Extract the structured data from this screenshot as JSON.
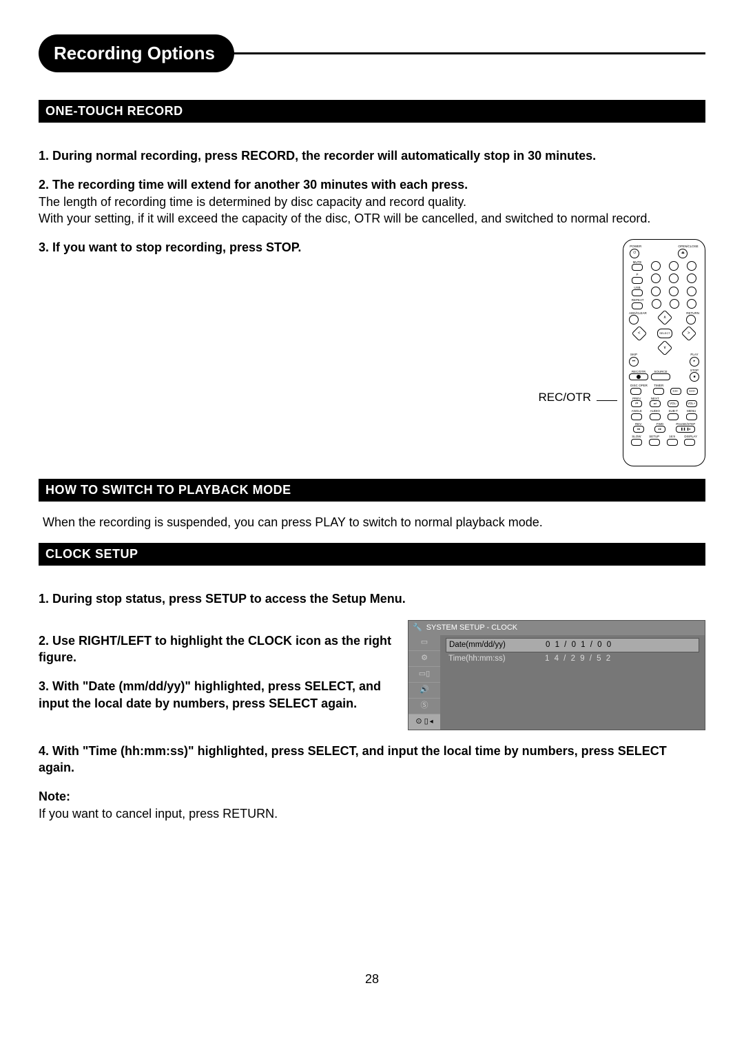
{
  "page_number": "28",
  "title": "Recording Options",
  "sections": {
    "otr": {
      "heading": "ONE-TOUCH RECORD",
      "step1": "1. During normal recording, press RECORD, the recorder will automatically stop in 30 minutes.",
      "step2": "2. The recording time will extend for another 30 minutes with each press.",
      "step2_note1": "The length of recording time is determined by disc capacity and record quality.",
      "step2_note2": "With your setting, if it will exceed the capacity of the disc,  OTR will be cancelled, and switched to normal record.",
      "step3": "3. If you want to stop recording, press STOP.",
      "remote_label": "REC/OTR"
    },
    "playback": {
      "heading": "HOW TO SWITCH TO PLAYBACK MODE",
      "text": "When the recording is suspended, you can press PLAY to switch to normal playback mode."
    },
    "clock": {
      "heading": "CLOCK SETUP",
      "step1": "1. During stop status, press SETUP to access the Setup Menu.",
      "step2": "2. Use RIGHT/LEFT to highlight the CLOCK icon as the right figure.",
      "step3": "3. With \"Date (mm/dd/yy)\" highlighted, press SELECT, and input the local date by numbers, press SELECT again.",
      "step4": "4. With \"Time (hh:mm:ss)\" highlighted, press SELECT, and input the local time by numbers, press SELECT again.",
      "note_label": "Note:",
      "note": "If you want to cancel input, press RETURN.",
      "fig": {
        "title": "SYSTEM SETUP - CLOCK",
        "date_label": "Date(mm/dd/yy)",
        "date_value": "0 1 / 0 1 / 0 0",
        "time_label": "Time(hh:mm:ss)",
        "time_value": "1 4 / 2 9 / 5 2"
      }
    }
  },
  "remote": {
    "labels": {
      "power": "POWER",
      "openclose": "OPEN/CLOSE",
      "mute": "MUTE",
      "pip": "P",
      "usb": "USB",
      "repeat": "REPEAT",
      "addclear": "ADD/CLEAR",
      "return": "RETURN",
      "select": "SELECT",
      "skip": "SKIP",
      "play": "PLAY",
      "rec": "REC/OTR",
      "source": "SOURCE",
      "stop": "STOP",
      "discoper": "DISC OPER",
      "timer": "TIMER",
      "chdn": "CH-",
      "chup": "CH+",
      "prev": "PREV",
      "next": "NEXT",
      "voldn": "VOL-",
      "volup": "VOL+",
      "angle": "ANGLE",
      "audio": "AUDIO",
      "subt": "SUB-T",
      "menu": "MENU",
      "rev": "REV",
      "fwd": "FWD",
      "pause": "PAUSE/STEP",
      "slow": "SLOW",
      "setup": "SETUP",
      "t169": "16:9",
      "display": "DISPLAY"
    }
  }
}
